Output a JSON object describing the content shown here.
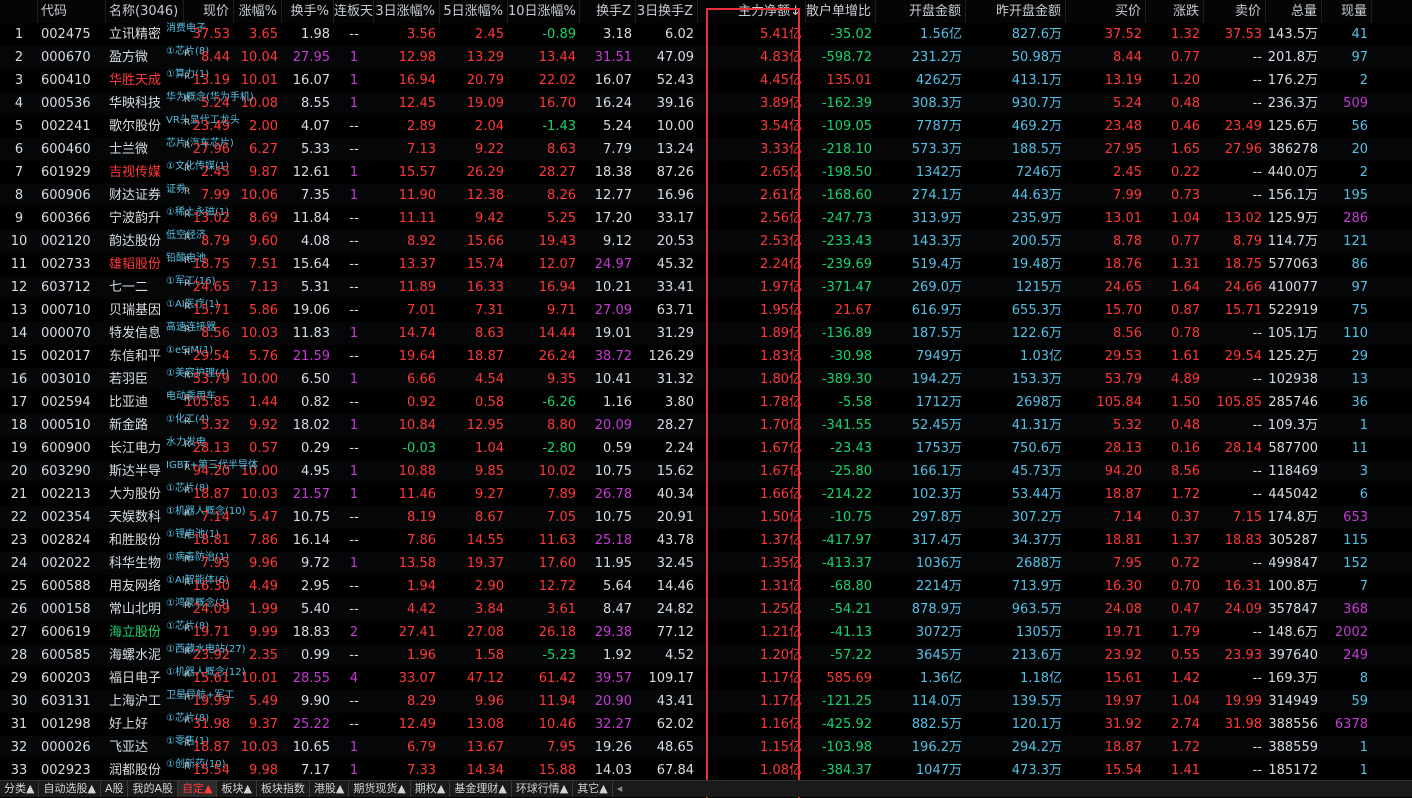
{
  "headers": [
    "",
    "代码",
    "名称(3046)",
    "现价",
    "涨幅%",
    "换手%",
    "连板天",
    "3日涨幅%",
    "5日涨幅%",
    "10日涨幅%",
    "换手Z",
    "3日换手Z",
    "主力净额↓",
    "散户单增比",
    "开盘金额",
    "昨开盘金额",
    "买价",
    "涨跌",
    "卖价",
    "总量",
    "现量"
  ],
  "colors": {
    "up": "#ff3838",
    "down": "#19d36b",
    "highlight_box": "#e8313a",
    "tag": "#56c1e6",
    "purple": "#c63bd6"
  },
  "rows": [
    {
      "n": "1",
      "code": "002475",
      "name": "立讯精密",
      "nc": "white",
      "tag": "消费电子",
      "r": "",
      "price": "37.53",
      "chg": "3.65",
      "turn": "1.98",
      "lb": "--",
      "d3": "3.56",
      "d5": "2.45",
      "d10": "-0.89",
      "tz": "3.18",
      "t3z": "6.02",
      "main": "5.41亿",
      "retail": "-35.02",
      "open": "1.56亿",
      "popen": "827.6万",
      "buy": "37.52",
      "diff": "1.32",
      "sell": "37.53",
      "vol": "143.5万",
      "cur": "41"
    },
    {
      "n": "2",
      "code": "000670",
      "name": "盈方微",
      "nc": "white",
      "tag": "①芯片(8)",
      "r": "R",
      "price": "8.44",
      "chg": "10.04",
      "turn": "27.95",
      "lb": "1",
      "d3": "12.98",
      "d5": "13.29",
      "d10": "13.44",
      "tz": "31.51",
      "t3z": "47.09",
      "main": "4.83亿",
      "retail": "-598.72",
      "open": "231.2万",
      "popen": "50.98万",
      "buy": "8.44",
      "diff": "0.77",
      "sell": "--",
      "vol": "201.8万",
      "cur": "97"
    },
    {
      "n": "3",
      "code": "600410",
      "name": "华胜天成",
      "nc": "red",
      "tag": "①算力(1)",
      "r": "R",
      "price": "13.19",
      "chg": "10.01",
      "turn": "16.07",
      "lb": "1",
      "d3": "16.94",
      "d5": "20.79",
      "d10": "22.02",
      "tz": "16.07",
      "t3z": "52.43",
      "main": "4.45亿",
      "retail": "135.01",
      "open": "4262万",
      "popen": "413.1万",
      "buy": "13.19",
      "diff": "1.20",
      "sell": "--",
      "vol": "176.2万",
      "cur": "2"
    },
    {
      "n": "4",
      "code": "000536",
      "name": "华映科技",
      "nc": "white",
      "tag": "华为概念(华为手机)",
      "r": "R",
      "price": "5.24",
      "chg": "10.08",
      "turn": "8.55",
      "lb": "1",
      "d3": "12.45",
      "d5": "19.09",
      "d10": "16.70",
      "tz": "16.24",
      "t3z": "39.16",
      "main": "3.89亿",
      "retail": "-162.39",
      "open": "308.3万",
      "popen": "930.7万",
      "buy": "5.24",
      "diff": "0.48",
      "sell": "--",
      "vol": "236.3万",
      "cur": "509"
    },
    {
      "n": "5",
      "code": "002241",
      "name": "歌尔股份",
      "nc": "white",
      "tag": "VR头显代工龙头",
      "r": "R",
      "price": "23.49",
      "chg": "2.00",
      "turn": "4.07",
      "lb": "--",
      "d3": "2.89",
      "d5": "2.04",
      "d10": "-1.43",
      "tz": "5.24",
      "t3z": "10.00",
      "main": "3.54亿",
      "retail": "-109.05",
      "open": "7787万",
      "popen": "469.2万",
      "buy": "23.48",
      "diff": "0.46",
      "sell": "23.49",
      "vol": "125.6万",
      "cur": "56"
    },
    {
      "n": "6",
      "code": "600460",
      "name": "士兰微",
      "nc": "white",
      "tag": "芯片(汽车芯片)",
      "r": "R",
      "price": "27.96",
      "chg": "6.27",
      "turn": "5.33",
      "lb": "--",
      "d3": "7.13",
      "d5": "9.22",
      "d10": "8.63",
      "tz": "7.79",
      "t3z": "13.24",
      "main": "3.33亿",
      "retail": "-218.10",
      "open": "573.3万",
      "popen": "188.5万",
      "buy": "27.95",
      "diff": "1.65",
      "sell": "27.96",
      "vol": "386278",
      "cur": "20"
    },
    {
      "n": "7",
      "code": "601929",
      "name": "吉视传媒",
      "nc": "red",
      "tag": "①文化传媒(1)",
      "r": "R",
      "price": "2.45",
      "chg": "9.87",
      "turn": "12.61",
      "lb": "1",
      "d3": "15.57",
      "d5": "26.29",
      "d10": "28.27",
      "tz": "18.38",
      "t3z": "87.26",
      "main": "2.65亿",
      "retail": "-198.50",
      "open": "1342万",
      "popen": "7246万",
      "buy": "2.45",
      "diff": "0.22",
      "sell": "--",
      "vol": "440.0万",
      "cur": "2"
    },
    {
      "n": "8",
      "code": "600906",
      "name": "财达证券",
      "nc": "white",
      "tag": "证券",
      "r": "R",
      "price": "7.99",
      "chg": "10.06",
      "turn": "7.35",
      "lb": "1",
      "d3": "11.90",
      "d5": "12.38",
      "d10": "8.26",
      "tz": "12.77",
      "t3z": "16.96",
      "main": "2.61亿",
      "retail": "-168.60",
      "open": "274.1万",
      "popen": "44.63万",
      "buy": "7.99",
      "diff": "0.73",
      "sell": "--",
      "vol": "156.1万",
      "cur": "195"
    },
    {
      "n": "9",
      "code": "600366",
      "name": "宁波韵升",
      "nc": "white",
      "tag": "①稀土永磁(1)",
      "r": "R",
      "price": "13.02",
      "chg": "8.69",
      "turn": "11.84",
      "lb": "--",
      "d3": "11.11",
      "d5": "9.42",
      "d10": "5.25",
      "tz": "17.20",
      "t3z": "33.17",
      "main": "2.56亿",
      "retail": "-247.73",
      "open": "313.9万",
      "popen": "235.9万",
      "buy": "13.01",
      "diff": "1.04",
      "sell": "13.02",
      "vol": "125.9万",
      "cur": "286"
    },
    {
      "n": "10",
      "code": "002120",
      "name": "韵达股份",
      "nc": "white",
      "tag": "低空经济",
      "r": "R",
      "price": "8.79",
      "chg": "9.60",
      "turn": "4.08",
      "lb": "--",
      "d3": "8.92",
      "d5": "15.66",
      "d10": "19.43",
      "tz": "9.12",
      "t3z": "20.53",
      "main": "2.53亿",
      "retail": "-233.43",
      "open": "143.3万",
      "popen": "200.5万",
      "buy": "8.78",
      "diff": "0.77",
      "sell": "8.79",
      "vol": "114.7万",
      "cur": "121"
    },
    {
      "n": "11",
      "code": "002733",
      "name": "雄韬股份",
      "nc": "red",
      "tag": "铅酸电池",
      "r": "R",
      "price": "18.75",
      "chg": "7.51",
      "turn": "15.64",
      "lb": "--",
      "d3": "13.37",
      "d5": "15.74",
      "d10": "12.07",
      "tz": "24.97",
      "t3z": "45.32",
      "main": "2.24亿",
      "retail": "-239.69",
      "open": "519.4万",
      "popen": "19.48万",
      "buy": "18.76",
      "diff": "1.31",
      "sell": "18.75",
      "vol": "577063",
      "cur": "86"
    },
    {
      "n": "12",
      "code": "603712",
      "name": "七一二",
      "nc": "white",
      "tag": "①军工(16)",
      "r": "R",
      "price": "24.65",
      "chg": "7.13",
      "turn": "5.31",
      "lb": "--",
      "d3": "11.89",
      "d5": "16.33",
      "d10": "16.94",
      "tz": "10.21",
      "t3z": "33.41",
      "main": "1.97亿",
      "retail": "-371.47",
      "open": "269.0万",
      "popen": "1215万",
      "buy": "24.65",
      "diff": "1.64",
      "sell": "24.66",
      "vol": "410077",
      "cur": "97"
    },
    {
      "n": "13",
      "code": "000710",
      "name": "贝瑞基因",
      "nc": "white",
      "tag": "①AI医疗(1)",
      "r": "R",
      "price": "15.71",
      "chg": "5.86",
      "turn": "19.06",
      "lb": "--",
      "d3": "7.01",
      "d5": "7.31",
      "d10": "9.71",
      "tz": "27.09",
      "t3z": "63.71",
      "main": "1.95亿",
      "retail": "21.67",
      "open": "616.9万",
      "popen": "655.3万",
      "buy": "15.70",
      "diff": "0.87",
      "sell": "15.71",
      "vol": "522919",
      "cur": "75"
    },
    {
      "n": "14",
      "code": "000070",
      "name": "特发信息",
      "nc": "white",
      "tag": "高速连接器",
      "r": "R",
      "price": "8.56",
      "chg": "10.03",
      "turn": "11.83",
      "lb": "1",
      "d3": "14.74",
      "d5": "8.63",
      "d10": "14.44",
      "tz": "19.01",
      "t3z": "31.29",
      "main": "1.89亿",
      "retail": "-136.89",
      "open": "187.5万",
      "popen": "122.6万",
      "buy": "8.56",
      "diff": "0.78",
      "sell": "--",
      "vol": "105.1万",
      "cur": "110"
    },
    {
      "n": "15",
      "code": "002017",
      "name": "东信和平",
      "nc": "white",
      "tag": "①eSIM(1)",
      "r": "R",
      "price": "29.54",
      "chg": "5.76",
      "turn": "21.59",
      "lb": "--",
      "d3": "19.64",
      "d5": "18.87",
      "d10": "26.24",
      "tz": "38.72",
      "t3z": "126.29",
      "main": "1.83亿",
      "retail": "-30.98",
      "open": "7949万",
      "popen": "1.03亿",
      "buy": "29.53",
      "diff": "1.61",
      "sell": "29.54",
      "vol": "125.2万",
      "cur": "29"
    },
    {
      "n": "16",
      "code": "003010",
      "name": "若羽臣",
      "nc": "white",
      "tag": "①美容护理(4)",
      "r": "R",
      "price": "53.79",
      "chg": "10.00",
      "turn": "6.50",
      "lb": "1",
      "d3": "6.66",
      "d5": "4.54",
      "d10": "9.35",
      "tz": "10.41",
      "t3z": "31.32",
      "main": "1.80亿",
      "retail": "-389.30",
      "open": "194.2万",
      "popen": "153.3万",
      "buy": "53.79",
      "diff": "4.89",
      "sell": "--",
      "vol": "102938",
      "cur": "13"
    },
    {
      "n": "17",
      "code": "002594",
      "name": "比亚迪",
      "nc": "white",
      "tag": "电动乘用车",
      "r": "R",
      "price": "105.85",
      "chg": "1.44",
      "turn": "0.82",
      "lb": "--",
      "d3": "0.92",
      "d5": "0.58",
      "d10": "-6.26",
      "tz": "1.16",
      "t3z": "3.80",
      "main": "1.78亿",
      "retail": "-5.58",
      "open": "1712万",
      "popen": "2698万",
      "buy": "105.84",
      "diff": "1.50",
      "sell": "105.85",
      "vol": "285746",
      "cur": "36"
    },
    {
      "n": "18",
      "code": "000510",
      "name": "新金路",
      "nc": "white",
      "tag": "①化工(4)",
      "r": "R",
      "price": "5.32",
      "chg": "9.92",
      "turn": "18.02",
      "lb": "1",
      "d3": "10.84",
      "d5": "12.95",
      "d10": "8.80",
      "tz": "20.09",
      "t3z": "28.27",
      "main": "1.70亿",
      "retail": "-341.55",
      "open": "52.45万",
      "popen": "41.31万",
      "buy": "5.32",
      "diff": "0.48",
      "sell": "--",
      "vol": "109.3万",
      "cur": "1"
    },
    {
      "n": "19",
      "code": "600900",
      "name": "长江电力",
      "nc": "white",
      "tag": "水力发电",
      "r": "R",
      "price": "28.13",
      "chg": "0.57",
      "turn": "0.29",
      "lb": "--",
      "d3": "-0.03",
      "d5": "1.04",
      "d10": "-2.80",
      "tz": "0.59",
      "t3z": "2.24",
      "main": "1.67亿",
      "retail": "-23.43",
      "open": "1753万",
      "popen": "750.6万",
      "buy": "28.13",
      "diff": "0.16",
      "sell": "28.14",
      "vol": "587700",
      "cur": "11"
    },
    {
      "n": "20",
      "code": "603290",
      "name": "斯达半导",
      "nc": "white",
      "tag": "IGBT+第三代半导体",
      "r": "R",
      "price": "94.20",
      "chg": "10.00",
      "turn": "4.95",
      "lb": "1",
      "d3": "10.88",
      "d5": "9.85",
      "d10": "10.02",
      "tz": "10.75",
      "t3z": "15.62",
      "main": "1.67亿",
      "retail": "-25.80",
      "open": "166.1万",
      "popen": "45.73万",
      "buy": "94.20",
      "diff": "8.56",
      "sell": "--",
      "vol": "118469",
      "cur": "3"
    },
    {
      "n": "21",
      "code": "002213",
      "name": "大为股份",
      "nc": "white",
      "tag": "①芯片(8)",
      "r": "R",
      "price": "18.87",
      "chg": "10.03",
      "turn": "21.57",
      "lb": "1",
      "d3": "11.46",
      "d5": "9.27",
      "d10": "7.89",
      "tz": "26.78",
      "t3z": "40.34",
      "main": "1.66亿",
      "retail": "-214.22",
      "open": "102.3万",
      "popen": "53.44万",
      "buy": "18.87",
      "diff": "1.72",
      "sell": "--",
      "vol": "445042",
      "cur": "6"
    },
    {
      "n": "22",
      "code": "002354",
      "name": "天娱数科",
      "nc": "white",
      "tag": "①机器人概念(10)",
      "r": "R",
      "price": "7.14",
      "chg": "5.47",
      "turn": "10.75",
      "lb": "--",
      "d3": "8.19",
      "d5": "8.67",
      "d10": "7.05",
      "tz": "10.75",
      "t3z": "20.91",
      "main": "1.50亿",
      "retail": "-10.75",
      "open": "297.8万",
      "popen": "307.2万",
      "buy": "7.14",
      "diff": "0.37",
      "sell": "7.15",
      "vol": "174.8万",
      "cur": "653"
    },
    {
      "n": "23",
      "code": "002824",
      "name": "和胜股份",
      "nc": "white",
      "tag": "①锂电池(1)",
      "r": "R",
      "price": "18.81",
      "chg": "7.86",
      "turn": "16.14",
      "lb": "--",
      "d3": "7.86",
      "d5": "14.55",
      "d10": "11.63",
      "tz": "25.18",
      "t3z": "43.78",
      "main": "1.37亿",
      "retail": "-417.97",
      "open": "317.4万",
      "popen": "34.37万",
      "buy": "18.81",
      "diff": "1.37",
      "sell": "18.83",
      "vol": "305287",
      "cur": "115"
    },
    {
      "n": "24",
      "code": "002022",
      "name": "科华生物",
      "nc": "white",
      "tag": "①病毒防治(1)",
      "r": "R",
      "price": "7.95",
      "chg": "9.96",
      "turn": "9.72",
      "lb": "1",
      "d3": "13.58",
      "d5": "19.37",
      "d10": "17.60",
      "tz": "11.95",
      "t3z": "32.45",
      "main": "1.35亿",
      "retail": "-413.37",
      "open": "1036万",
      "popen": "2688万",
      "buy": "7.95",
      "diff": "0.72",
      "sell": "--",
      "vol": "499847",
      "cur": "152"
    },
    {
      "n": "25",
      "code": "600588",
      "name": "用友网络",
      "nc": "white",
      "tag": "①AI智能体(6)",
      "r": "R",
      "price": "16.30",
      "chg": "4.49",
      "turn": "2.95",
      "lb": "--",
      "d3": "1.94",
      "d5": "2.90",
      "d10": "12.72",
      "tz": "5.64",
      "t3z": "14.46",
      "main": "1.31亿",
      "retail": "-68.80",
      "open": "2214万",
      "popen": "713.9万",
      "buy": "16.30",
      "diff": "0.70",
      "sell": "16.31",
      "vol": "100.8万",
      "cur": "7"
    },
    {
      "n": "26",
      "code": "000158",
      "name": "常山北明",
      "nc": "white",
      "tag": "①鸿蒙概念(3)",
      "r": "R",
      "price": "24.09",
      "chg": "1.99",
      "turn": "5.40",
      "lb": "--",
      "d3": "4.42",
      "d5": "3.84",
      "d10": "3.61",
      "tz": "8.47",
      "t3z": "24.82",
      "main": "1.25亿",
      "retail": "-54.21",
      "open": "878.9万",
      "popen": "963.5万",
      "buy": "24.08",
      "diff": "0.47",
      "sell": "24.09",
      "vol": "357847",
      "cur": "368"
    },
    {
      "n": "27",
      "code": "600619",
      "name": "海立股份",
      "nc": "green",
      "tag": "①芯片(8)",
      "r": "R",
      "price": "19.71",
      "chg": "9.99",
      "turn": "18.83",
      "lb": "2",
      "d3": "27.41",
      "d5": "27.08",
      "d10": "26.18",
      "tz": "29.38",
      "t3z": "77.12",
      "main": "1.21亿",
      "retail": "-41.13",
      "open": "3072万",
      "popen": "1305万",
      "buy": "19.71",
      "diff": "1.79",
      "sell": "--",
      "vol": "148.6万",
      "cur": "2002"
    },
    {
      "n": "28",
      "code": "600585",
      "name": "海螺水泥",
      "nc": "white",
      "tag": "①西藏水电站(27)",
      "r": "R",
      "price": "23.92",
      "chg": "2.35",
      "turn": "0.99",
      "lb": "--",
      "d3": "1.96",
      "d5": "1.58",
      "d10": "-5.23",
      "tz": "1.92",
      "t3z": "4.52",
      "main": "1.20亿",
      "retail": "-57.22",
      "open": "3645万",
      "popen": "213.6万",
      "buy": "23.92",
      "diff": "0.55",
      "sell": "23.93",
      "vol": "397640",
      "cur": "249"
    },
    {
      "n": "29",
      "code": "600203",
      "name": "福日电子",
      "nc": "white",
      "tag": "①机器人概念(12)",
      "r": "R",
      "price": "15.61",
      "chg": "10.01",
      "turn": "28.55",
      "lb": "4",
      "d3": "33.07",
      "d5": "47.12",
      "d10": "61.42",
      "tz": "39.57",
      "t3z": "109.17",
      "main": "1.17亿",
      "retail": "585.69",
      "open": "1.36亿",
      "popen": "1.18亿",
      "buy": "15.61",
      "diff": "1.42",
      "sell": "--",
      "vol": "169.3万",
      "cur": "8"
    },
    {
      "n": "30",
      "code": "603131",
      "name": "上海沪工",
      "nc": "white",
      "tag": "卫星导航+军工",
      "r": "R",
      "price": "19.99",
      "chg": "5.49",
      "turn": "9.90",
      "lb": "--",
      "d3": "8.29",
      "d5": "9.96",
      "d10": "11.94",
      "tz": "20.90",
      "t3z": "43.41",
      "main": "1.17亿",
      "retail": "-121.25",
      "open": "114.0万",
      "popen": "139.5万",
      "buy": "19.97",
      "diff": "1.04",
      "sell": "19.99",
      "vol": "314949",
      "cur": "59"
    },
    {
      "n": "31",
      "code": "001298",
      "name": "好上好",
      "nc": "white",
      "tag": "①芯片(8)",
      "r": "R",
      "price": "31.98",
      "chg": "9.37",
      "turn": "25.22",
      "lb": "--",
      "d3": "12.49",
      "d5": "13.08",
      "d10": "10.46",
      "tz": "32.27",
      "t3z": "62.02",
      "main": "1.16亿",
      "retail": "-425.92",
      "open": "882.5万",
      "popen": "120.1万",
      "buy": "31.92",
      "diff": "2.74",
      "sell": "31.98",
      "vol": "388556",
      "cur": "6378"
    },
    {
      "n": "32",
      "code": "000026",
      "name": "飞亚达",
      "nc": "white",
      "tag": "①零售(1)",
      "r": "R",
      "price": "18.87",
      "chg": "10.03",
      "turn": "10.65",
      "lb": "1",
      "d3": "6.79",
      "d5": "13.67",
      "d10": "7.95",
      "tz": "19.26",
      "t3z": "48.65",
      "main": "1.15亿",
      "retail": "-103.98",
      "open": "196.2万",
      "popen": "294.2万",
      "buy": "18.87",
      "diff": "1.72",
      "sell": "--",
      "vol": "388559",
      "cur": "1"
    },
    {
      "n": "33",
      "code": "002923",
      "name": "润都股份",
      "nc": "white",
      "tag": "①创新药(10)",
      "r": "R",
      "price": "15.54",
      "chg": "9.98",
      "turn": "7.17",
      "lb": "1",
      "d3": "7.33",
      "d5": "14.34",
      "d10": "15.88",
      "tz": "14.03",
      "t3z": "67.84",
      "main": "1.08亿",
      "retail": "-384.37",
      "open": "1047万",
      "popen": "473.3万",
      "buy": "15.54",
      "diff": "1.41",
      "sell": "--",
      "vol": "185172",
      "cur": "1"
    }
  ],
  "tabs": [
    "分类▲",
    "自动选股▲",
    "A股",
    "我的A股",
    "自定▲",
    "板块▲",
    "板块指数",
    "港股▲",
    "期货现货▲",
    "期权▲",
    "基金理财▲",
    "环球行情▲",
    "其它▲"
  ],
  "active_tab": "自定▲",
  "tab_scroll": "◂"
}
